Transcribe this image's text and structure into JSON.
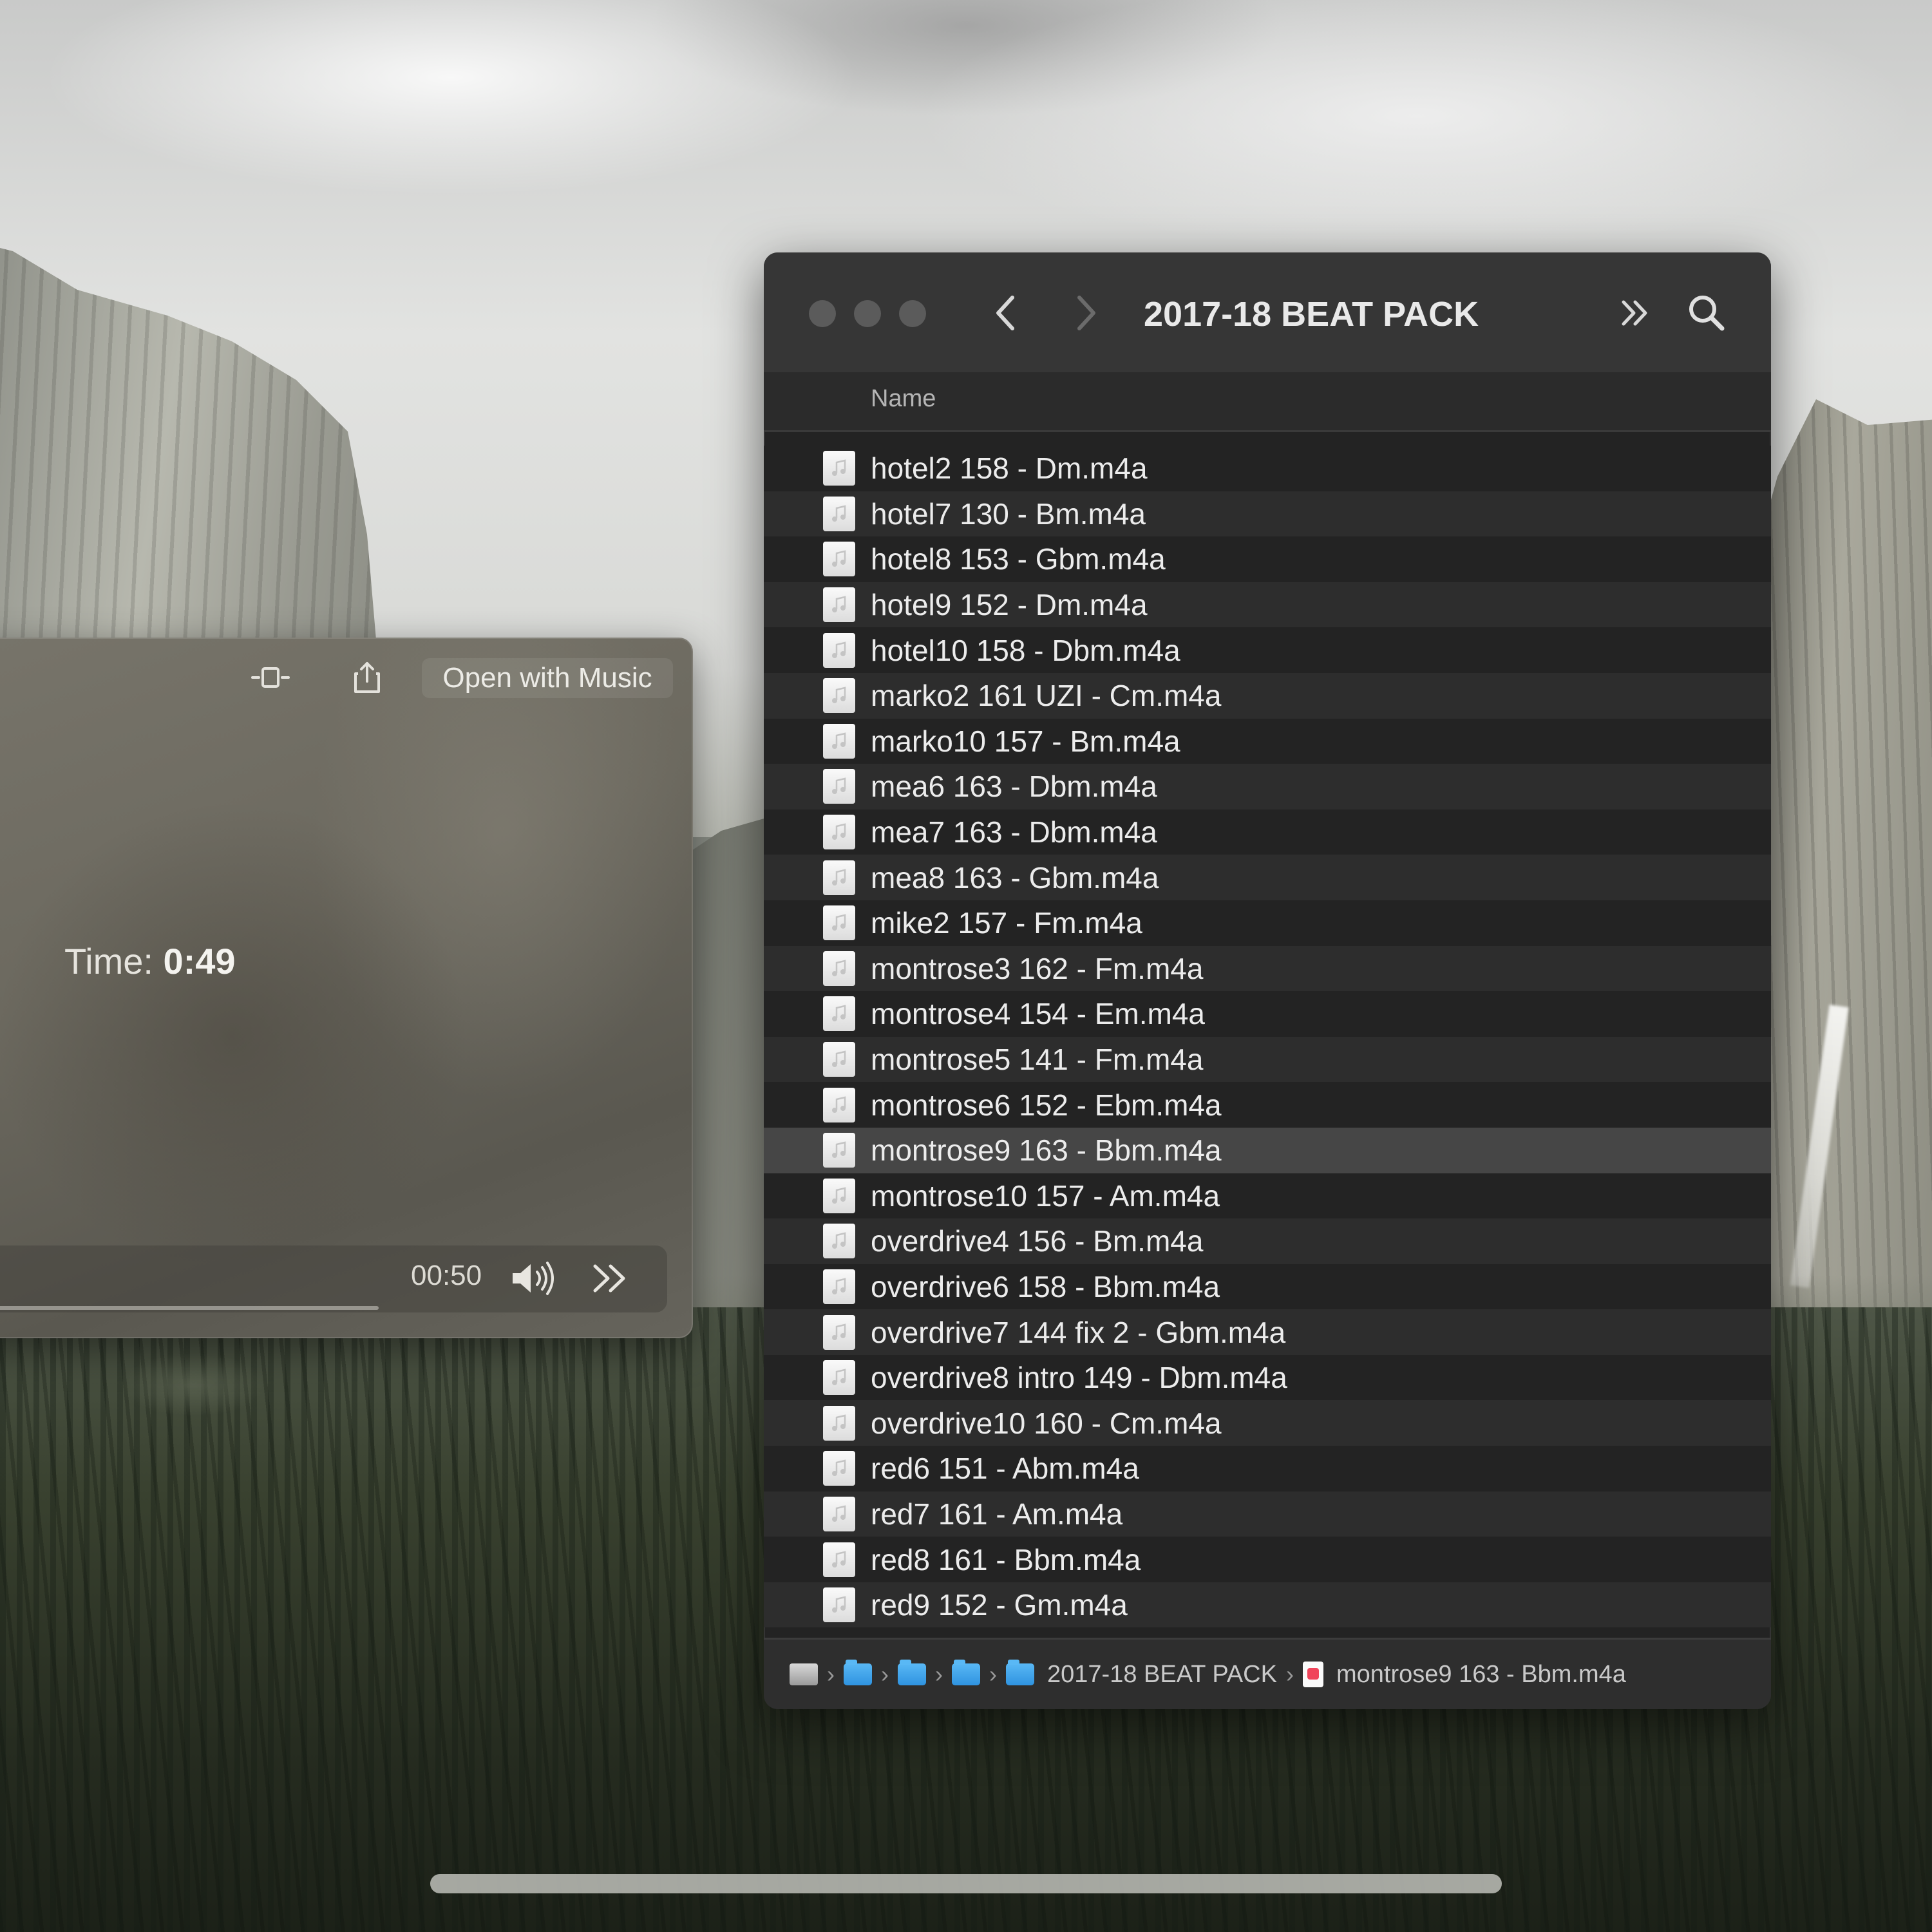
{
  "player": {
    "open_with_label": "Open with Music",
    "time_label": "Time:",
    "time_value": "0:49",
    "elapsed": "00:50",
    "icons": [
      "trim-icon",
      "share-icon",
      "volume-icon",
      "fast-forward-icon"
    ]
  },
  "finder": {
    "title": "2017-18 BEAT PACK",
    "column_header": "Name",
    "files": [
      "hotel2 158 - Dm.m4a",
      "hotel7 130 - Bm.m4a",
      "hotel8 153 - Gbm.m4a",
      "hotel9 152 - Dm.m4a",
      "hotel10 158 - Dbm.m4a",
      "marko2 161 UZI - Cm.m4a",
      "marko10 157 - Bm.m4a",
      "mea6 163 - Dbm.m4a",
      "mea7 163 - Dbm.m4a",
      "mea8 163 - Gbm.m4a",
      "mike2 157 - Fm.m4a",
      "montrose3 162 - Fm.m4a",
      "montrose4 154 - Em.m4a",
      "montrose5 141 - Fm.m4a",
      "montrose6 152 - Ebm.m4a",
      "montrose9 163 - Bbm.m4a",
      "montrose10 157 - Am.m4a",
      "overdrive4 156 - Bm.m4a",
      "overdrive6 158 - Bbm.m4a",
      "overdrive7 144 fix 2 - Gbm.m4a",
      "overdrive8 intro 149 - Dbm.m4a",
      "overdrive10 160 - Cm.m4a",
      "red6 151 - Abm.m4a",
      "red7 161 - Am.m4a",
      "red8 161 - Bbm.m4a",
      "red9 152 - Gm.m4a"
    ],
    "selected_file": "montrose9 163 - Bbm.m4a",
    "path_bar": {
      "folder": "2017-18 BEAT PACK",
      "file": "montrose9 163 - Bbm.m4a"
    }
  },
  "colors": {
    "finder_bg": "#232323",
    "row_alt": "#2d2d2d",
    "row_selected": "#464646",
    "folder_blue": "#2f93e0"
  }
}
